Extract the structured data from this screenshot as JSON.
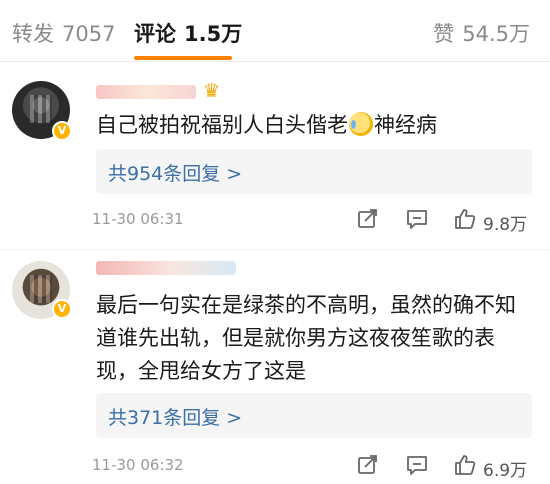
{
  "tabs": {
    "repost": {
      "label": "转发",
      "count": "7057"
    },
    "comment": {
      "label": "评论",
      "count": "1.5万"
    },
    "like": {
      "label": "赞",
      "count": "54.5万"
    }
  },
  "comments": [
    {
      "text_a": "自己被拍祝福别人白头偕老",
      "text_b": "神经病",
      "replies": "共954条回复 >",
      "time": "11-30 06:31",
      "likes": "9.8万"
    },
    {
      "text": "最后一句实在是绿茶的不高明，虽然的确不知道谁先出轨，但是就你男方这夜夜笙歌的表现，全甩给女方了这是",
      "replies": "共371条回复 >",
      "time": "11-30 06:32",
      "likes": "6.9万"
    }
  ],
  "icons": {
    "share": "share-icon",
    "comment": "comment-icon",
    "like": "thumbs-up-icon",
    "verified": "verified-v-badge",
    "crown": "crown-icon"
  },
  "colors": {
    "accent": "#ff8200",
    "link": "#3a6ea8",
    "verified_badge": "#ffb400"
  }
}
